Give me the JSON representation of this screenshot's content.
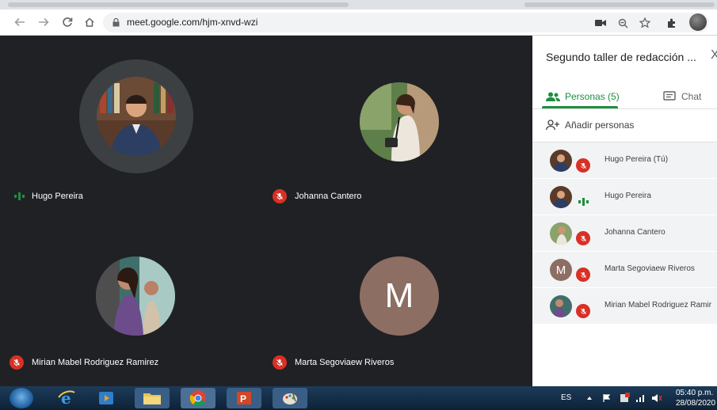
{
  "browser": {
    "url": "meet.google.com/hjm-xnvd-wzi",
    "icons": [
      "back-icon",
      "forward-icon",
      "reload-icon",
      "home-icon",
      "lock-icon",
      "camera-icon",
      "zoom-icon",
      "star-icon",
      "extensions-icon",
      "profile-avatar"
    ]
  },
  "participants_grid": [
    {
      "name": "Hugo Pereira",
      "status": "speaking",
      "avatar": "photo"
    },
    {
      "name": "Johanna Cantero",
      "status": "muted",
      "avatar": "photo"
    },
    {
      "name": "Mirian Mabel Rodriguez Ramirez",
      "status": "muted",
      "avatar": "photo"
    },
    {
      "name": "Marta Segoviaew Riveros",
      "status": "muted",
      "avatar": "letter",
      "letter": "M"
    }
  ],
  "sidebar": {
    "meeting_title": "Segundo taller de redacción ...",
    "close_label": "X",
    "tabs": {
      "people": "Personas (5)",
      "chat": "Chat"
    },
    "add_people": "Añadir personas",
    "people": [
      {
        "name": "Hugo Pereira (Tú)",
        "status": "muted"
      },
      {
        "name": "Hugo Pereira",
        "status": "speaking"
      },
      {
        "name": "Johanna Cantero",
        "status": "muted"
      },
      {
        "name": "Marta Segoviaew Riveros",
        "status": "muted",
        "letter": "M"
      },
      {
        "name": "Mirian Mabel Rodriguez Ramir",
        "status": "muted"
      }
    ]
  },
  "taskbar": {
    "language": "ES",
    "time": "05:40 p.m.",
    "date": "28/08/2020"
  },
  "colors": {
    "stage_bg": "#202124",
    "muted_red": "#d93025",
    "meet_green": "#1e8e3e",
    "letter_avatar": "#8d6e63"
  }
}
